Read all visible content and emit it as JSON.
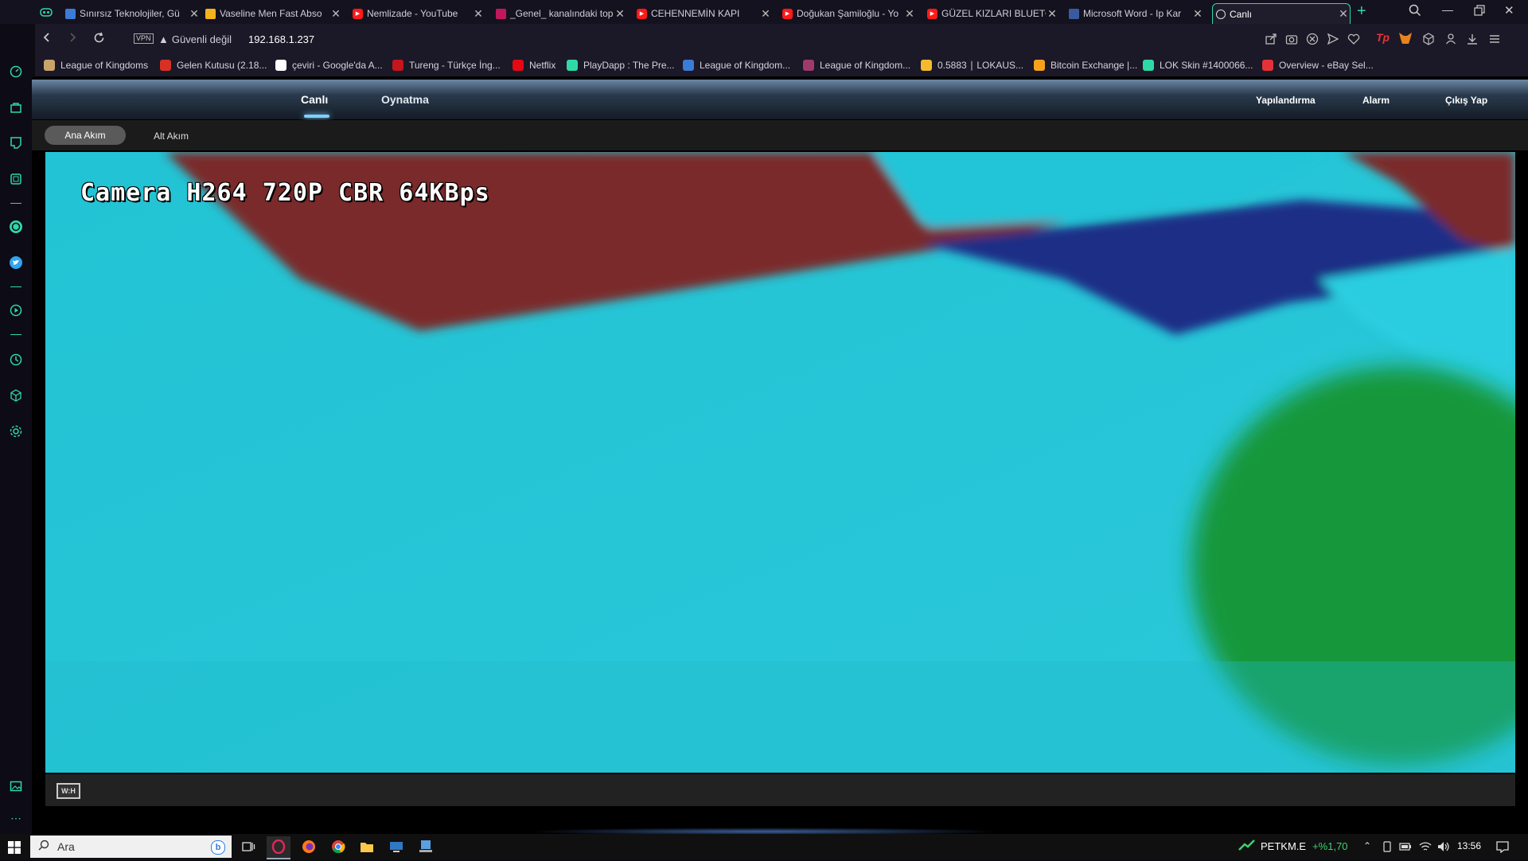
{
  "browser": {
    "tabs": [
      {
        "title": "Sınırsız Teknolojiler, Gü",
        "icon": "triangle-logo-icon",
        "color": "#3b7cd6"
      },
      {
        "title": "Vaseline Men Fast Abso",
        "icon": "walmart-icon",
        "color": "#f6b21b"
      },
      {
        "title": "Nemlizade - YouTube",
        "icon": "youtube-icon",
        "color": "#ff1a1a"
      },
      {
        "title": "_Genel_ kanalındaki top",
        "icon": "play-logo-icon",
        "color": "#c2185b"
      },
      {
        "title": "CEHENNEMİN KAPI",
        "icon": "youtube-icon",
        "color": "#ff1a1a"
      },
      {
        "title": "Doğukan Şamiloğlu - Yo",
        "icon": "youtube-icon",
        "color": "#ff1a1a"
      },
      {
        "title": "GÜZEL KIZLARI BLUETO",
        "icon": "youtube-icon",
        "color": "#ff1a1a"
      },
      {
        "title": "Microsoft Word - Ip Kar",
        "icon": "document-icon",
        "color": "#3a5ba0"
      },
      {
        "title": "Canlı",
        "icon": "globe-icon",
        "color": "#dddddd"
      }
    ],
    "security_label": "Güvenli değil",
    "vpn_label": "VPN",
    "url": "192.168.1.237",
    "bookmarks": [
      {
        "label": "League of Kingdoms",
        "color": "#c8a46a"
      },
      {
        "label": "Gelen Kutusu (2.18...",
        "color": "#d93025"
      },
      {
        "label": "çeviri - Google'da A...",
        "color": "#ffffff"
      },
      {
        "label": "Tureng - Türkçe İng...",
        "color": "#c4161c"
      },
      {
        "label": "Netflix",
        "color": "#e50914"
      },
      {
        "label": "PlayDapp : The Pre...",
        "color": "#2fd9a7"
      },
      {
        "label": "League of Kingdom...",
        "color": "#3b7cd6"
      },
      {
        "label": "League of Kingdom...",
        "color": "#a03a6a"
      },
      {
        "label": "0.5883 ∣ LOKAUS...",
        "color": "#f3ba2f"
      },
      {
        "label": "Bitcoin Exchange |...",
        "color": "#f7a21b"
      },
      {
        "label": "LOK Skin #1400066...",
        "color": "#2fd9a7"
      },
      {
        "label": "Overview - eBay Sel...",
        "color": "#e53238"
      }
    ]
  },
  "camera_app": {
    "nav_left": [
      "Canlı",
      "Oynatma"
    ],
    "nav_right": [
      "Yapılandırma",
      "Alarm",
      "Çıkış Yap"
    ],
    "streams": [
      "Ana Akım",
      "Alt Akım"
    ],
    "osd_text": "Camera H264 720P CBR 64KBps",
    "ratio_button": "W:H"
  },
  "taskbar": {
    "search_placeholder": "Ara",
    "ticker_symbol": "PETKM.E",
    "ticker_change": "+%1,70",
    "time": "13:56"
  }
}
